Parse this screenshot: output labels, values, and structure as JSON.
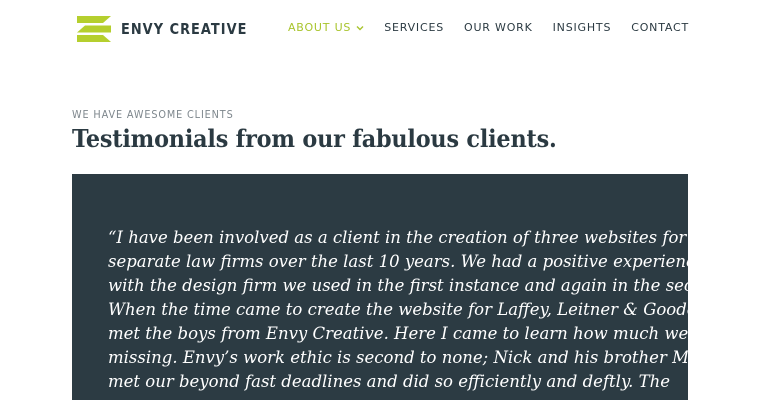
{
  "brand": {
    "name": "ENVY CREATIVE",
    "logo_icon": "stacked-slash-bars-icon",
    "accent_color": "#a8c42c"
  },
  "nav": {
    "items": [
      {
        "label": "ABOUT US",
        "active": true,
        "has_dropdown": true
      },
      {
        "label": "SERVICES"
      },
      {
        "label": "OUR WORK"
      },
      {
        "label": "INSIGHTS"
      },
      {
        "label": "CONTACT"
      }
    ]
  },
  "section": {
    "eyebrow": "WE HAVE AWESOME CLIENTS",
    "title": "Testimonials from our fabulous clients."
  },
  "testimonial": {
    "panel_color": "#2c3b43",
    "lines": [
      "“I have been involved as a client in the creation of three websites for three",
      "separate law firms over the last 10 years. We had a positive experience",
      "with the design firm we used in the first instance and again in the second.",
      "When the time came to create the website for Laffey, Leitner & Goode, we",
      "met the boys from Envy Creative. Here I came to learn how much we were",
      "missing. Envy’s work ethic is second to none; Nick and his brother Mike",
      "met our beyond fast deadlines and did so efficiently and deftly. The"
    ]
  }
}
